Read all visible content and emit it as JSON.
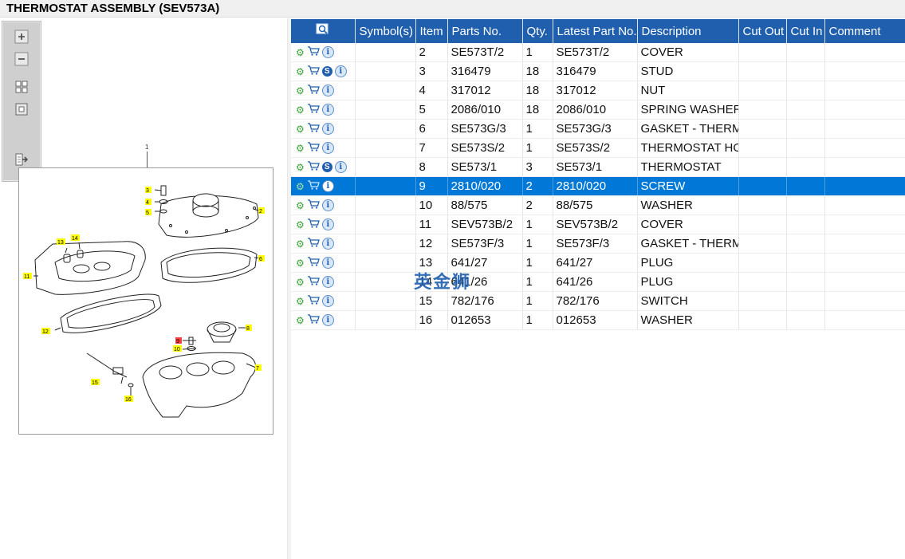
{
  "title": "THERMOSTAT ASSEMBLY (SEV573A)",
  "toolbar": {
    "tools": [
      "zoom-in-icon",
      "zoom-out-icon",
      "fit-page-icon",
      "actual-size-icon",
      "export-icon"
    ]
  },
  "drawing": {
    "top_label": "1",
    "callouts": [
      "2",
      "3",
      "4",
      "5",
      "6",
      "7",
      "8",
      "9",
      "10",
      "11",
      "12",
      "13",
      "14",
      "15",
      "16"
    ],
    "highlight_callout": "9"
  },
  "table": {
    "headers": [
      "",
      "Symbol(s)",
      "Item",
      "Parts No.",
      "Qty.",
      "Latest Part No.",
      "Description",
      "Cut Out",
      "Cut In",
      "Comment"
    ],
    "rows": [
      {
        "icons": [
          "gear",
          "cart",
          "info"
        ],
        "item": "2",
        "part": "SE573T/2",
        "qty": "1",
        "latest": "SE573T/2",
        "desc": "COVER"
      },
      {
        "icons": [
          "gear",
          "cart",
          "s",
          "info"
        ],
        "item": "3",
        "part": "316479",
        "qty": "18",
        "latest": "316479",
        "desc": "STUD"
      },
      {
        "icons": [
          "gear",
          "cart",
          "info"
        ],
        "item": "4",
        "part": "317012",
        "qty": "18",
        "latest": "317012",
        "desc": "NUT"
      },
      {
        "icons": [
          "gear",
          "cart",
          "info"
        ],
        "item": "5",
        "part": "2086/010",
        "qty": "18",
        "latest": "2086/010",
        "desc": "SPRING WASHER"
      },
      {
        "icons": [
          "gear",
          "cart",
          "info"
        ],
        "item": "6",
        "part": "SE573G/3",
        "qty": "1",
        "latest": "SE573G/3",
        "desc": "GASKET - THERMOSTAT"
      },
      {
        "icons": [
          "gear",
          "cart",
          "info"
        ],
        "item": "7",
        "part": "SE573S/2",
        "qty": "1",
        "latest": "SE573S/2",
        "desc": "THERMOSTAT HOUSING"
      },
      {
        "icons": [
          "gear",
          "cart",
          "s",
          "info"
        ],
        "item": "8",
        "part": "SE573/1",
        "qty": "3",
        "latest": "SE573/1",
        "desc": "THERMOSTAT"
      },
      {
        "icons": [
          "gear",
          "cart",
          "info"
        ],
        "item": "9",
        "part": "2810/020",
        "qty": "2",
        "latest": "2810/020",
        "desc": "SCREW",
        "selected": true
      },
      {
        "icons": [
          "gear",
          "cart",
          "info"
        ],
        "item": "10",
        "part": "88/575",
        "qty": "2",
        "latest": "88/575",
        "desc": "WASHER"
      },
      {
        "icons": [
          "gear",
          "cart",
          "info"
        ],
        "item": "11",
        "part": "SEV573B/2",
        "qty": "1",
        "latest": "SEV573B/2",
        "desc": "COVER"
      },
      {
        "icons": [
          "gear",
          "cart",
          "info"
        ],
        "item": "12",
        "part": "SE573F/3",
        "qty": "1",
        "latest": "SE573F/3",
        "desc": "GASKET - THERMOSTAT"
      },
      {
        "icons": [
          "gear",
          "cart",
          "info"
        ],
        "item": "13",
        "part": "641/27",
        "qty": "1",
        "latest": "641/27",
        "desc": "PLUG"
      },
      {
        "icons": [
          "gear",
          "cart",
          "info"
        ],
        "item": "14",
        "part": "641/26",
        "qty": "1",
        "latest": "641/26",
        "desc": "PLUG"
      },
      {
        "icons": [
          "gear",
          "cart",
          "info"
        ],
        "item": "15",
        "part": "782/176",
        "qty": "1",
        "latest": "782/176",
        "desc": "SWITCH"
      },
      {
        "icons": [
          "gear",
          "cart",
          "info"
        ],
        "item": "16",
        "part": "012653",
        "qty": "1",
        "latest": "012653",
        "desc": "WASHER"
      }
    ]
  },
  "watermark": "英金狮",
  "colors": {
    "header_bg": "#1f5fae",
    "selected_row": "#0078d7",
    "callout_yellow": "#ffff00",
    "callout_red": "#ff4040"
  }
}
